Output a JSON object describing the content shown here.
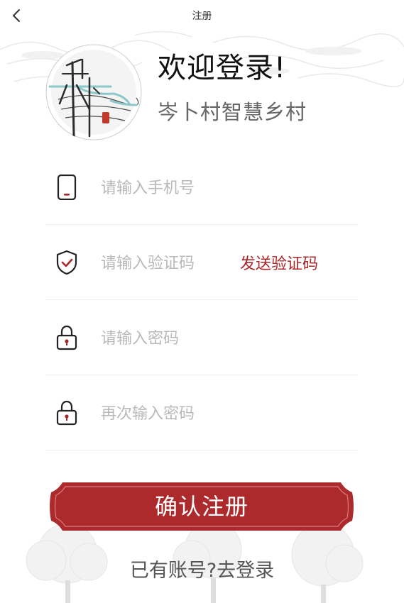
{
  "header": {
    "title": "注册",
    "back_icon": "chevron-left-icon"
  },
  "hero": {
    "welcome": "欢迎登录!",
    "village_name": "岑卜村智慧乡村"
  },
  "form": {
    "phone_placeholder": "请输入手机号",
    "code_placeholder": "请输入验证码",
    "send_code_label": "发送验证码",
    "password_placeholder": "请输入密码",
    "confirm_password_placeholder": "再次输入密码"
  },
  "actions": {
    "confirm_label": "确认注册",
    "login_link": "已有账号?去登录"
  },
  "colors": {
    "accent": "#a8282a",
    "button_fill": "#ad2a2c",
    "text_dark": "#111111",
    "placeholder": "#b9b9b9"
  }
}
